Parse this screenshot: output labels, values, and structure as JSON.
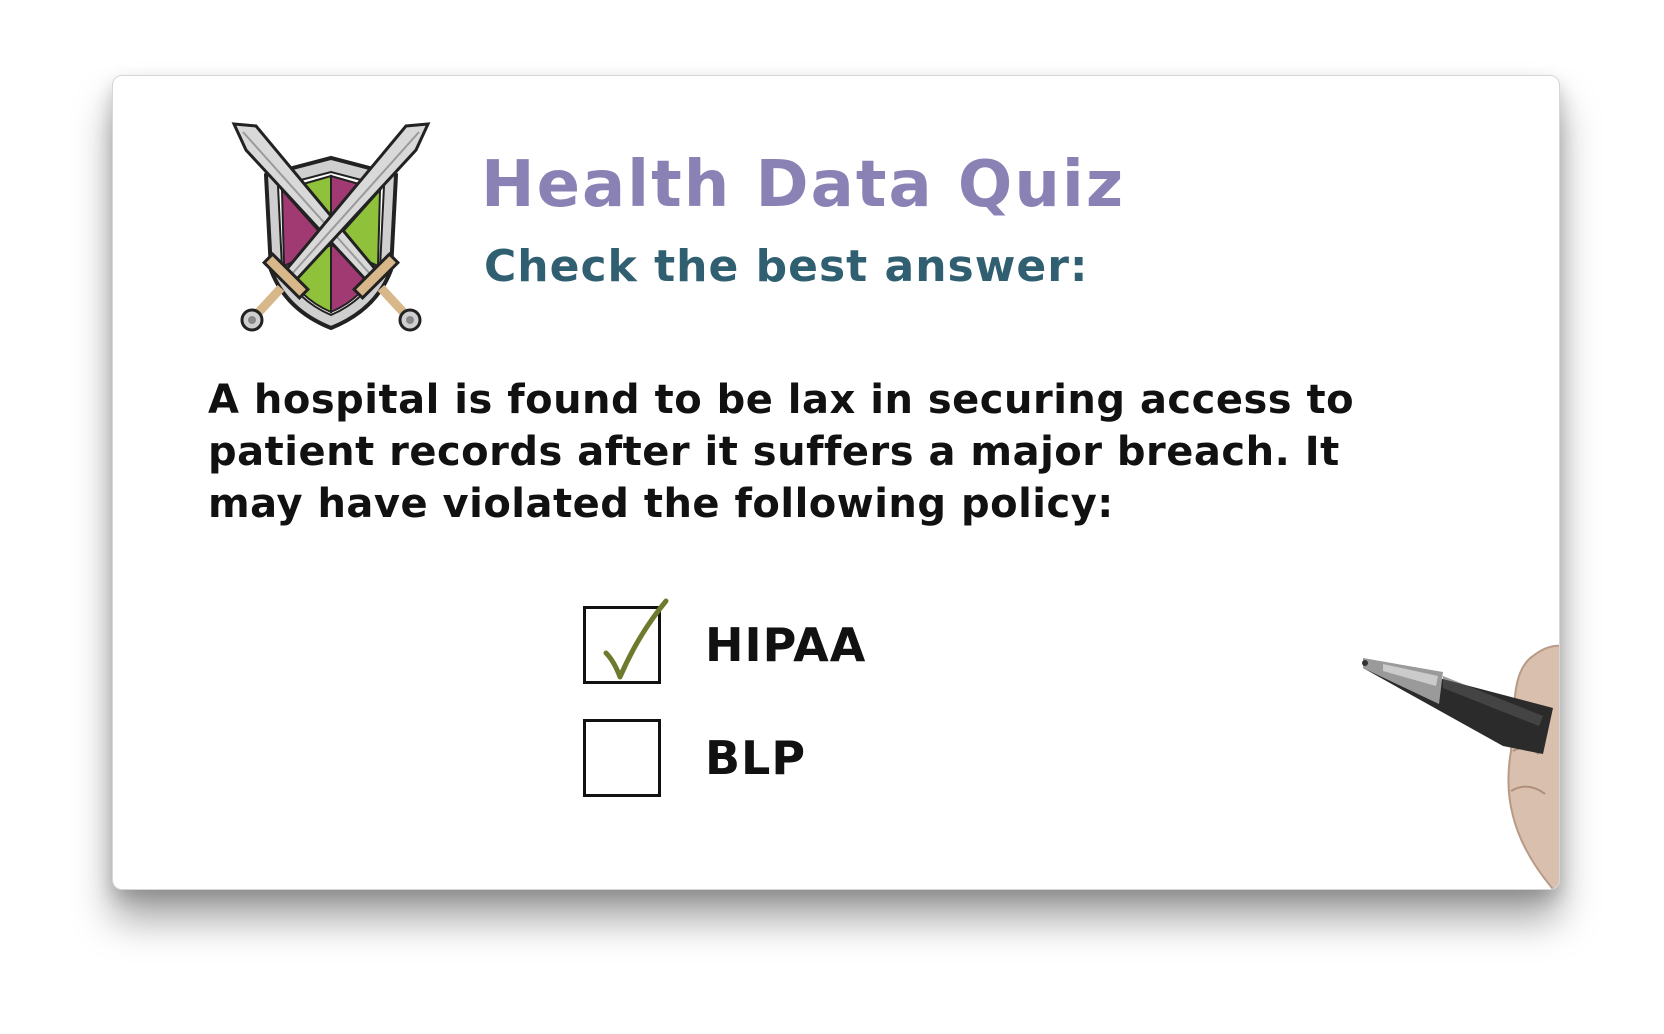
{
  "quiz": {
    "title": "Health Data Quiz",
    "subtitle": "Check the best answer:",
    "question": "A hospital is found to be lax in securing access to patient records after it suffers a major breach. It may have violated the following policy:",
    "options": [
      {
        "label": "HIPAA",
        "checked": true
      },
      {
        "label": "BLP",
        "checked": false
      }
    ]
  },
  "icons": {
    "emblem": "crossed-swords-shield-icon",
    "checkmark": "checkmark-icon",
    "pen": "pen-hand-icon"
  },
  "colors": {
    "title": "#8a82b4",
    "subtitle": "#2f5f70",
    "text": "#111111",
    "checkmark": "#6f7a2e",
    "shield_green": "#8fc13a",
    "shield_magenta": "#a13a73"
  }
}
